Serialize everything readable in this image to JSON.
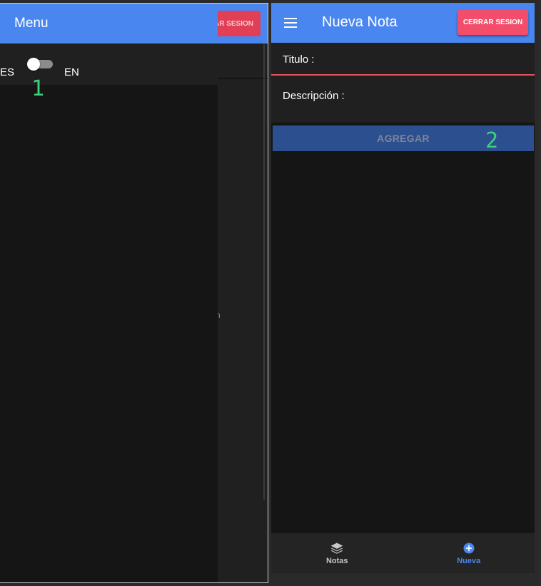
{
  "left": {
    "underlying": {
      "logout_partial": "AR SESION",
      "stray_char": "n"
    },
    "drawer": {
      "title": "Menu",
      "language": {
        "left_label": "ES",
        "right_label": "EN",
        "selected": "ES"
      }
    },
    "annotation": "1"
  },
  "right": {
    "app_bar": {
      "title": "Nueva Nota",
      "logout_label": "CERRAR SESION"
    },
    "form": {
      "title_label": "Titulo :",
      "title_value": "",
      "description_label": "Descripción :",
      "description_value": ""
    },
    "add_button": "AGREGAR",
    "annotation": "2",
    "bottom_nav": [
      {
        "label": "Notas",
        "icon": "layers-icon",
        "active": false
      },
      {
        "label": "Nueva",
        "icon": "add-circle-icon",
        "active": true
      }
    ]
  },
  "colors": {
    "primary": "#4a86f0",
    "danger": "#f24d6a",
    "background": "#151515",
    "annotation": "#3ed07a"
  }
}
